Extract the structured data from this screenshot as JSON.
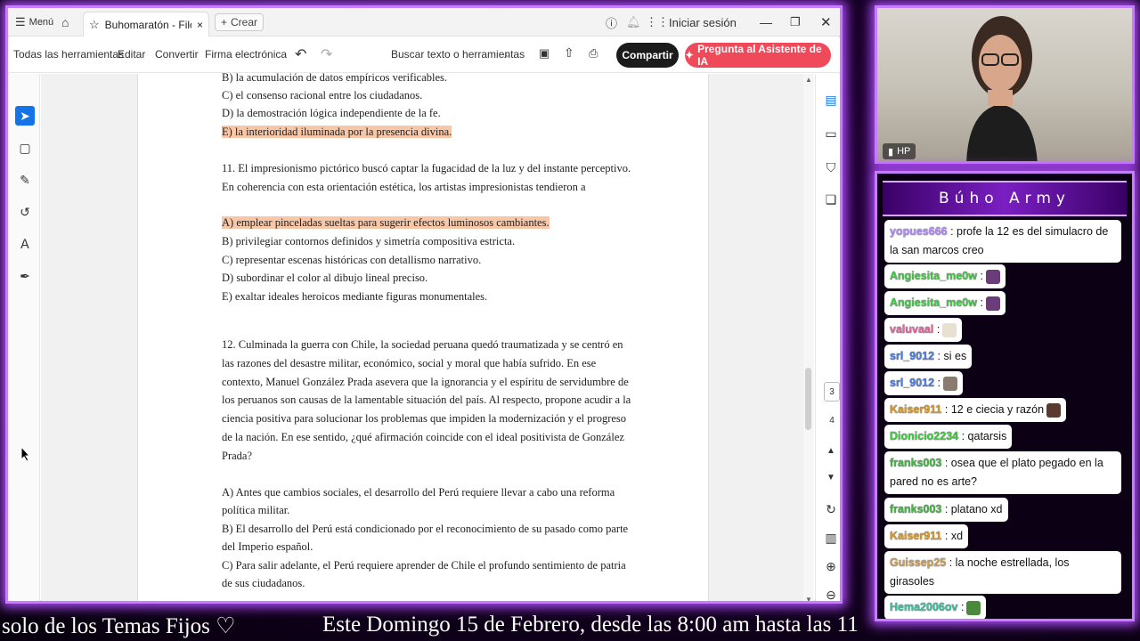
{
  "browser": {
    "menu_label": "Menú",
    "tab_title": "Buhomaratón - Filos...",
    "new_tab_label": "Crear",
    "signin_label": "Iniciar sesión"
  },
  "toolbar": {
    "all_tools": "Todas las herramientas",
    "edit": "Editar",
    "convert": "Convertir",
    "esign": "Firma electrónica",
    "search_placeholder": "Buscar texto o herramientas",
    "share": "Compartir",
    "ai_assistant": "Pregunta al Asistente de IA"
  },
  "document": {
    "lines": [
      {
        "text": "B) la acumulación de datos empíricos verificables.",
        "hl": false
      },
      {
        "text": "C) el consenso racional entre los ciudadanos.",
        "hl": false
      },
      {
        "text": "D) la demostración lógica independiente de la fe.",
        "hl": false
      },
      {
        "text": "E) la interioridad iluminada por la presencia divina.",
        "hl": true
      },
      {
        "text": "11. El impresionismo pictórico buscó captar la fugacidad de la luz y del instante perceptivo.",
        "hl": false
      },
      {
        "text": "En coherencia con esta orientación estética, los artistas impresionistas tendieron a",
        "hl": false
      },
      {
        "text": "A) emplear pinceladas sueltas para sugerir efectos luminosos cambiantes.",
        "hl": true
      },
      {
        "text": "B) privilegiar contornos definidos y simetría compositiva estricta.",
        "hl": false
      },
      {
        "text": "C) representar escenas históricas con detallismo narrativo.",
        "hl": false
      },
      {
        "text": "D) subordinar el color al dibujo lineal preciso.",
        "hl": false
      },
      {
        "text": "E) exaltar ideales heroicos mediante figuras monumentales.",
        "hl": false
      },
      {
        "text": "12. Culminada la guerra con Chile, la sociedad peruana quedó traumatizada y se centró en",
        "hl": false
      },
      {
        "text": "las razones del desastre militar, económico, social y moral que había sufrido. En ese",
        "hl": false
      },
      {
        "text": "contexto, Manuel González Prada asevera que la ignorancia y el espíritu de servidumbre de",
        "hl": false
      },
      {
        "text": "los peruanos son causas de la lamentable situación del país. Al respecto, propone acudir a la",
        "hl": false
      },
      {
        "text": "ciencia positiva para solucionar los problemas que impiden la modernización y el progreso",
        "hl": false
      },
      {
        "text": "de la nación. En ese sentido, ¿qué afirmación coincide con el ideal positivista de González",
        "hl": false
      },
      {
        "text": "Prada?",
        "hl": false
      },
      {
        "text": "A) Antes que cambios sociales, el desarrollo del Perú requiere llevar a cabo una reforma",
        "hl": false
      },
      {
        "text": "política militar.",
        "hl": false
      },
      {
        "text": "B) El desarrollo del Perú está condicionado por el reconocimiento de su pasado como parte",
        "hl": false
      },
      {
        "text": "del Imperio español.",
        "hl": false
      },
      {
        "text": "C) Para salir adelante, el Perú requiere aprender de Chile el profundo sentimiento de patria",
        "hl": false
      },
      {
        "text": "de sus ciudadanos.",
        "hl": false
      }
    ]
  },
  "pages": {
    "current": "3",
    "next": "4"
  },
  "webcam": {
    "label": "HP"
  },
  "chat": {
    "title": "Búho Army",
    "messages": [
      {
        "user": "yopues666",
        "color": "#b48cff",
        "text": ": profe la 12 es del simulacro de la san marcos creo",
        "emote": ""
      },
      {
        "user": "Angiesita_me0w",
        "color": "#46c94a",
        "text": ":",
        "emote": "#6a3d7a"
      },
      {
        "user": "Angiesita_me0w",
        "color": "#46c94a",
        "text": ":",
        "emote": "#6a3d7a"
      },
      {
        "user": "valuvaal",
        "color": "#e06aa0",
        "text": ":",
        "emote": "#e8e0d0"
      },
      {
        "user": "srl_9012",
        "color": "#4d7fe0",
        "text": ": si es",
        "emote": ""
      },
      {
        "user": "srl_9012",
        "color": "#4d7fe0",
        "text": ":",
        "emote": "#8a7a70"
      },
      {
        "user": "Kaiser911",
        "color": "#d99a2b",
        "text": ": 12 e ciecia y razón",
        "emote": "#5a3a30"
      },
      {
        "user": "Dionicio2234",
        "color": "#3fcf3f",
        "text": ": qatarsis",
        "emote": ""
      },
      {
        "user": "franks003",
        "color": "#48b648",
        "text": ": osea que el plato pegado en la pared no es arte?",
        "emote": ""
      },
      {
        "user": "franks003",
        "color": "#48b648",
        "text": ": platano xd",
        "emote": ""
      },
      {
        "user": "Kaiser911",
        "color": "#d99a2b",
        "text": ": xd",
        "emote": ""
      },
      {
        "user": "Guissep25",
        "color": "#c9a060",
        "text": ": la noche estrellada, los girasoles",
        "emote": ""
      },
      {
        "user": "Hema2006ov",
        "color": "#3fbf9f",
        "text": ":",
        "emote": "#4a8a3a"
      }
    ]
  },
  "ticker": {
    "left": "solo de los Temas Fijos ♡",
    "right": "Este Domingo 15 de Febrero, desde las 8:00 am hasta las 11"
  }
}
